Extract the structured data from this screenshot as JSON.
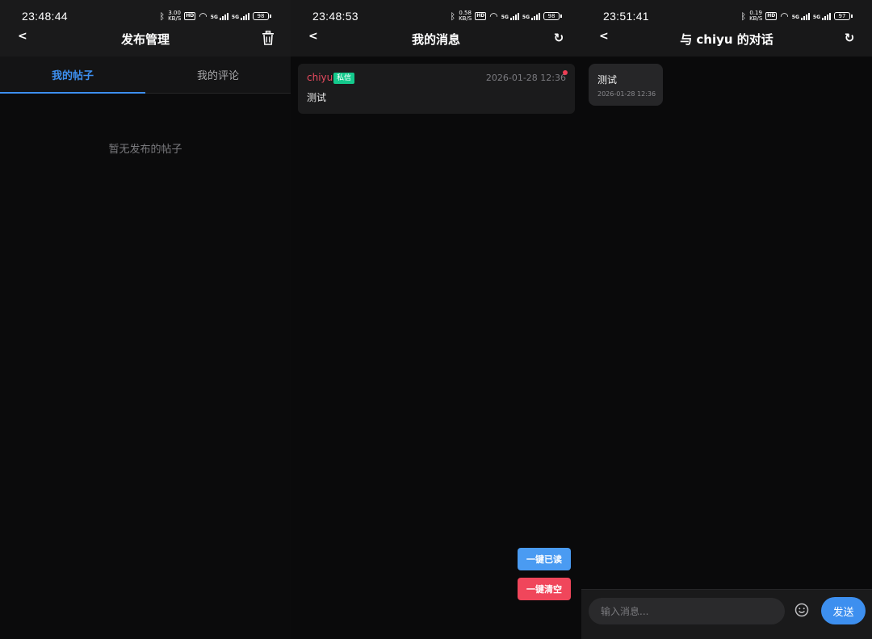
{
  "colors": {
    "accent": "#3d8fef",
    "danger": "#f0465b",
    "tag_green": "#14c98c",
    "sender_red": "#e84a5f"
  },
  "screens": [
    {
      "status": {
        "time": "23:48:44",
        "speed_value": "3.00",
        "speed_unit": "KB/S",
        "hd": "HD",
        "signal_label_1": "5G",
        "signal_label_2": "5G",
        "battery": "98"
      },
      "header": {
        "back": "<",
        "title": "发布管理",
        "right_icon": "trash-icon"
      },
      "tabs": [
        {
          "label": "我的帖子",
          "active": true
        },
        {
          "label": "我的评论",
          "active": false
        }
      ],
      "empty_text": "暂无发布的帖子"
    },
    {
      "status": {
        "time": "23:48:53",
        "speed_value": "0.58",
        "speed_unit": "KB/S",
        "hd": "HD",
        "signal_label_1": "5G",
        "signal_label_2": "5G",
        "battery": "98"
      },
      "header": {
        "back": "<",
        "title": "我的消息",
        "right_icon": "refresh-icon",
        "right_glyph": "↻"
      },
      "messages": [
        {
          "sender": "chiyu",
          "tag": "私信",
          "timestamp": "2026-01-28 12:36",
          "body": "测试",
          "unread": true
        }
      ],
      "buttons": {
        "mark_all_read": "一键已读",
        "clear_all": "一键清空"
      }
    },
    {
      "status": {
        "time": "23:51:41",
        "speed_value": "0.19",
        "speed_unit": "KB/S",
        "hd": "HD",
        "signal_label_1": "5G",
        "signal_label_2": "5G",
        "battery": "97"
      },
      "header": {
        "back": "<",
        "title": "与 chiyu 的对话",
        "right_icon": "refresh-icon",
        "right_glyph": "↻"
      },
      "chat": [
        {
          "text": "测试",
          "timestamp": "2026-01-28 12:36"
        }
      ],
      "composer": {
        "placeholder": "输入消息...",
        "emoji_icon": "emoji-icon",
        "send_label": "发送"
      }
    }
  ]
}
